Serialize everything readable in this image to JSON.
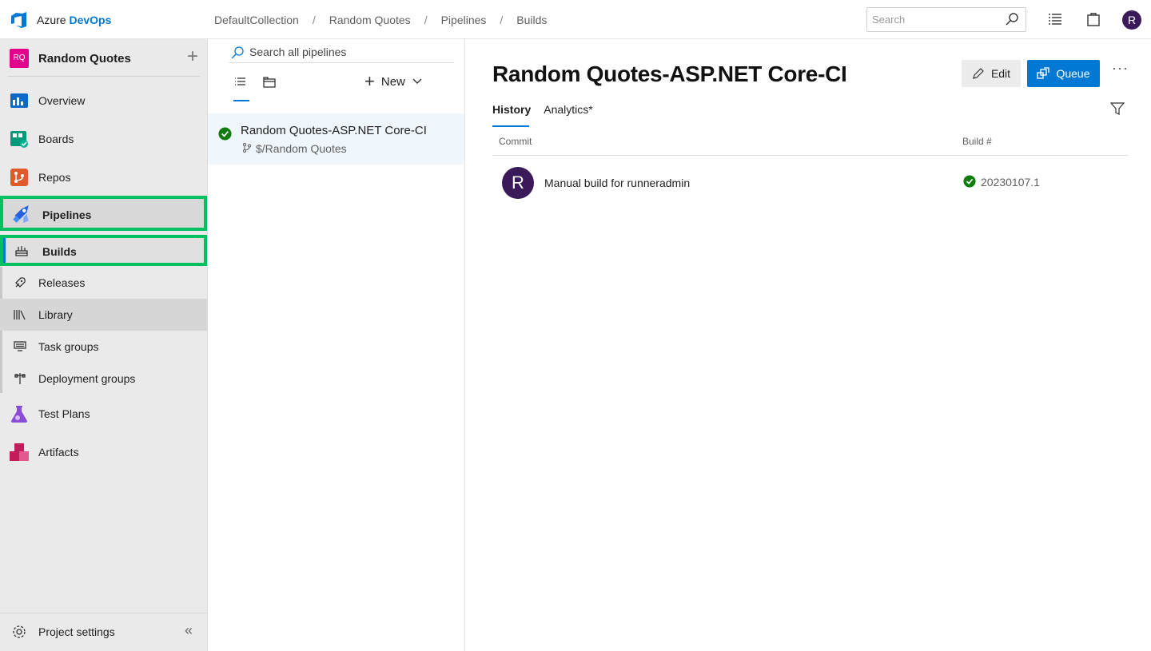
{
  "header": {
    "brand_part1": "Azure",
    "brand_part2": "DevOps",
    "breadcrumbs": [
      "DefaultCollection",
      "Random Quotes",
      "Pipelines",
      "Builds"
    ],
    "search_placeholder": "Search",
    "avatar_initial": "R"
  },
  "sidebar": {
    "project_badge": "RQ",
    "project_name": "Random Quotes",
    "items": [
      {
        "label": "Overview",
        "icon": "overview-icon"
      },
      {
        "label": "Boards",
        "icon": "boards-icon"
      },
      {
        "label": "Repos",
        "icon": "repos-icon"
      },
      {
        "label": "Pipelines",
        "icon": "pipelines-icon"
      },
      {
        "label": "Builds",
        "icon": "builds-icon"
      },
      {
        "label": "Releases",
        "icon": "rocket-icon"
      },
      {
        "label": "Library",
        "icon": "library-icon"
      },
      {
        "label": "Task groups",
        "icon": "task-groups-icon"
      },
      {
        "label": "Deployment groups",
        "icon": "deployment-groups-icon"
      },
      {
        "label": "Test Plans",
        "icon": "test-plans-icon"
      },
      {
        "label": "Artifacts",
        "icon": "artifacts-icon"
      }
    ],
    "settings_label": "Project settings",
    "collapse_glyph": "«"
  },
  "list": {
    "search_placeholder": "Search all pipelines",
    "new_label": "New",
    "pipelines": [
      {
        "name": "Random Quotes-ASP.NET Core-CI",
        "path": "$/Random Quotes",
        "status": "succeeded"
      }
    ]
  },
  "main": {
    "title": "Random Quotes-ASP.NET Core-CI",
    "edit_label": "Edit",
    "queue_label": "Queue",
    "more_label": "···",
    "tabs": [
      "History",
      "Analytics*"
    ],
    "columns": {
      "commit": "Commit",
      "build": "Build #"
    },
    "rows": [
      {
        "avatar": "R",
        "commit": "Manual build for runneradmin",
        "build": "20230107.1",
        "status": "succeeded"
      }
    ]
  },
  "colors": {
    "accent": "#0078d4",
    "success": "#107c10",
    "highlight": "#00c060",
    "project_badge": "#e3008c"
  }
}
